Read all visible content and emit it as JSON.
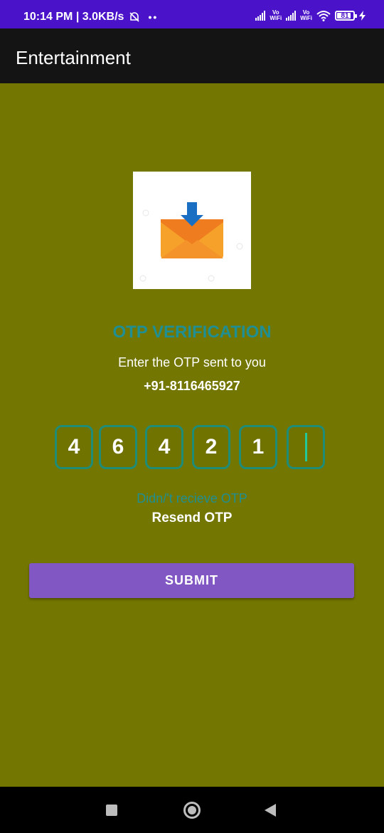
{
  "status_bar": {
    "time_speed": "10:14 PM | 3.0KB/s",
    "dots": "••",
    "volte1": "Vo\nWiFi",
    "volte2": "Vo\nWiFi",
    "battery": "81"
  },
  "app_bar": {
    "title": "Entertainment"
  },
  "otp": {
    "title": "OTP VERIFICATION",
    "subtitle": "Enter the OTP sent to you",
    "phone": "+91-8116465927",
    "digits": [
      "4",
      "6",
      "4",
      "2",
      "1",
      ""
    ],
    "didnt_receive": "Didn/'t recieve OTP",
    "resend": "Resend OTP",
    "submit": "SUBMIT"
  },
  "colors": {
    "background": "#737600",
    "accent": "#1f8f93",
    "button": "#8157c3",
    "status_bar": "#4a12c9"
  },
  "icons": {
    "logo": "envelope-download-icon",
    "nav": [
      "recents-square-icon",
      "home-circle-icon",
      "back-triangle-icon"
    ]
  }
}
